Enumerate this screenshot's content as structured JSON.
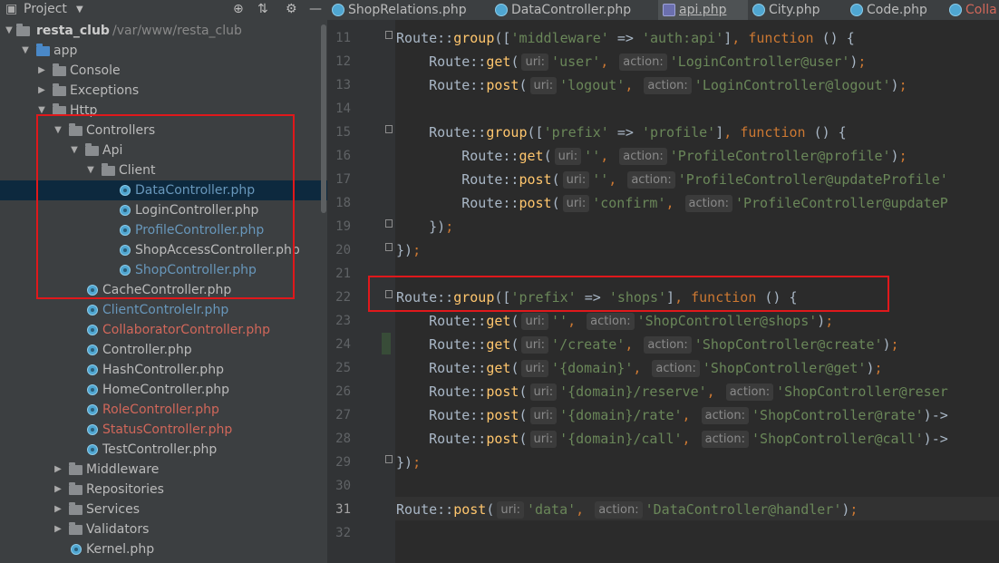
{
  "project_panel": {
    "title": "Project",
    "root_name": "resta_club",
    "root_path": "/var/www/resta_club",
    "tree": [
      {
        "label": "app"
      },
      {
        "label": "Console"
      },
      {
        "label": "Exceptions"
      },
      {
        "label": "Http"
      },
      {
        "label": "Controllers"
      },
      {
        "label": "Api"
      },
      {
        "label": "Client"
      },
      {
        "label": "DataController.php"
      },
      {
        "label": "LoginController.php"
      },
      {
        "label": "ProfileController.php"
      },
      {
        "label": "ShopAccessController.php"
      },
      {
        "label": "ShopController.php"
      },
      {
        "label": "CacheController.php"
      },
      {
        "label": "ClientControlelr.php"
      },
      {
        "label": "CollaboratorController.php"
      },
      {
        "label": "Controller.php"
      },
      {
        "label": "HashController.php"
      },
      {
        "label": "HomeController.php"
      },
      {
        "label": "RoleController.php"
      },
      {
        "label": "StatusController.php"
      },
      {
        "label": "TestController.php"
      },
      {
        "label": "Middleware"
      },
      {
        "label": "Repositories"
      },
      {
        "label": "Services"
      },
      {
        "label": "Validators"
      },
      {
        "label": "Kernel.php"
      }
    ]
  },
  "tabs": [
    {
      "label": "ShopRelations.php"
    },
    {
      "label": "DataController.php"
    },
    {
      "label": "api.php"
    },
    {
      "label": "City.php"
    },
    {
      "label": "Code.php"
    },
    {
      "label": "Colla"
    }
  ],
  "editor": {
    "current_line": 31,
    "lines": [
      {
        "n": "11",
        "text": "Route::group(['middleware' => 'auth:api'], function () {"
      },
      {
        "n": "12",
        "text": "    Route::get( uri: 'user',  action: 'LoginController@user');"
      },
      {
        "n": "13",
        "text": "    Route::post( uri: 'logout',  action: 'LoginController@logout');"
      },
      {
        "n": "14",
        "text": ""
      },
      {
        "n": "15",
        "text": "    Route::group(['prefix' => 'profile'], function () {"
      },
      {
        "n": "16",
        "text": "        Route::get( uri: '',  action: 'ProfileController@profile');"
      },
      {
        "n": "17",
        "text": "        Route::post( uri: '',  action: 'ProfileController@updateProfile'"
      },
      {
        "n": "18",
        "text": "        Route::post( uri: 'confirm',  action: 'ProfileController@updateP"
      },
      {
        "n": "19",
        "text": "    });"
      },
      {
        "n": "20",
        "text": "});"
      },
      {
        "n": "21",
        "text": ""
      },
      {
        "n": "22",
        "text": "Route::group(['prefix' => 'shops'], function () {"
      },
      {
        "n": "23",
        "text": "    Route::get( uri: '',  action: 'ShopController@shops');"
      },
      {
        "n": "24",
        "text": "    Route::get( uri: '/create',  action: 'ShopController@create');"
      },
      {
        "n": "25",
        "text": "    Route::get( uri: '{domain}',  action: 'ShopController@get');"
      },
      {
        "n": "26",
        "text": "    Route::post( uri: '{domain}/reserve',  action: 'ShopController@reser"
      },
      {
        "n": "27",
        "text": "    Route::post( uri: '{domain}/rate',  action: 'ShopController@rate')->"
      },
      {
        "n": "28",
        "text": "    Route::post( uri: '{domain}/call',  action: 'ShopController@call')->"
      },
      {
        "n": "29",
        "text": "});"
      },
      {
        "n": "30",
        "text": ""
      },
      {
        "n": "31",
        "text": "Route::post( uri: 'data',  action: 'DataController@handler');"
      },
      {
        "n": "32",
        "text": ""
      }
    ]
  },
  "colors": {
    "keyword": "#cc7832",
    "string": "#6a8759",
    "method": "#ffc66d",
    "default": "#a9b7c6",
    "annotation_box": "#e0181b"
  }
}
